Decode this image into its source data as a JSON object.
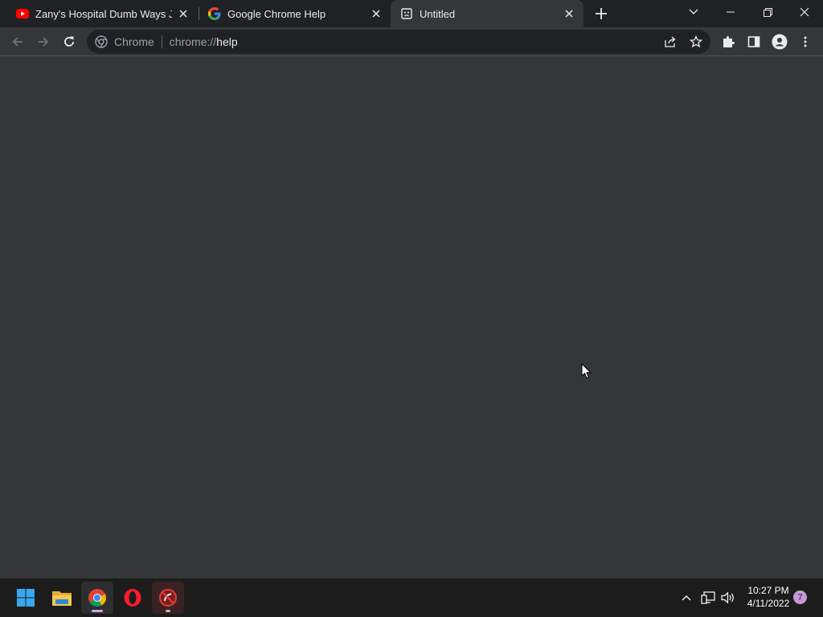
{
  "tabs": [
    {
      "title": "Zany's Hospital Dumb Ways Jr - ",
      "favicon": "youtube-icon"
    },
    {
      "title": "Google Chrome Help",
      "favicon": "google-icon"
    },
    {
      "title": "Untitled",
      "favicon": "sad-page-icon",
      "active": true
    }
  ],
  "omnibox": {
    "chip": "Chrome",
    "url_scheme": "chrome://",
    "url_host": "help"
  },
  "taskbar": {
    "apps": [
      "windows-start-icon",
      "file-explorer-icon",
      "chrome-icon",
      "opera-icon",
      "blocked-app-icon"
    ],
    "clock_time": "10:27 PM",
    "clock_date": "4/11/2022",
    "notification_count": "7"
  },
  "colors": {
    "tabstrip": "#202124",
    "toolbar": "#35363a",
    "omnibox": "#202124",
    "taskbar": "#1c1c1c",
    "accent": "#c29ad8"
  }
}
